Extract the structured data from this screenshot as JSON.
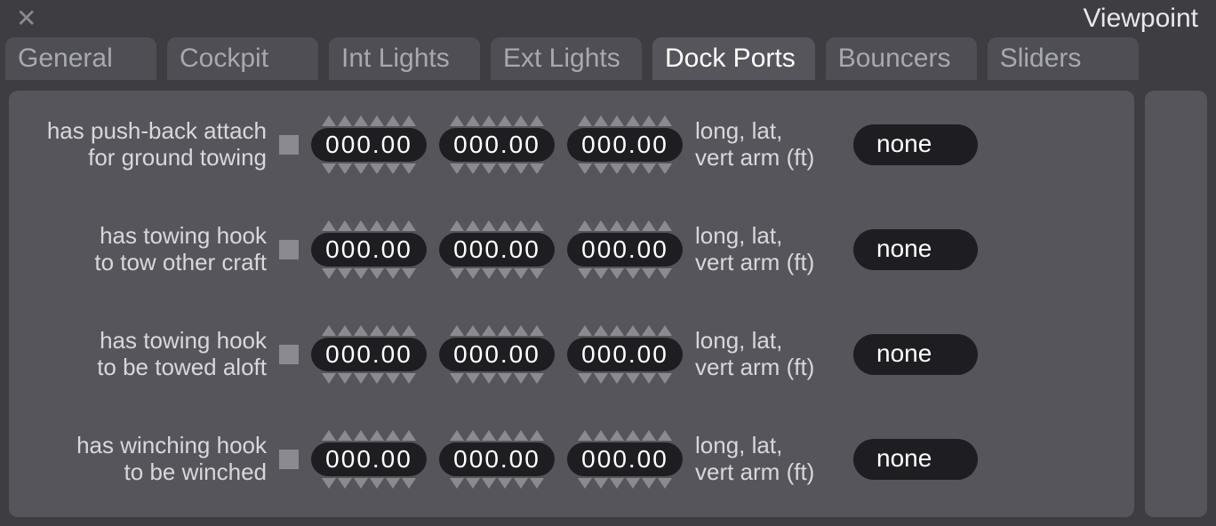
{
  "window": {
    "title": "Viewpoint"
  },
  "tabs": [
    {
      "label": "General",
      "active": false
    },
    {
      "label": "Cockpit",
      "active": false
    },
    {
      "label": "Int Lights",
      "active": false
    },
    {
      "label": "Ext Lights",
      "active": false
    },
    {
      "label": "Dock Ports",
      "active": true
    },
    {
      "label": "Bouncers",
      "active": false
    },
    {
      "label": "Sliders",
      "active": false
    }
  ],
  "units_label": {
    "line1": "long, lat,",
    "line2": "vert arm (ft)"
  },
  "rows": [
    {
      "label_line1": "has push-back attach",
      "label_line2": "for ground towing",
      "v1": "000.00",
      "v2": "000.00",
      "v3": "000.00",
      "dropdown": "none"
    },
    {
      "label_line1": "has towing hook",
      "label_line2": "to tow other craft",
      "v1": "000.00",
      "v2": "000.00",
      "v3": "000.00",
      "dropdown": "none"
    },
    {
      "label_line1": "has towing hook",
      "label_line2": "to be towed aloft",
      "v1": "000.00",
      "v2": "000.00",
      "v3": "000.00",
      "dropdown": "none"
    },
    {
      "label_line1": "has winching hook",
      "label_line2": "to be winched",
      "v1": "000.00",
      "v2": "000.00",
      "v3": "000.00",
      "dropdown": "none"
    }
  ]
}
